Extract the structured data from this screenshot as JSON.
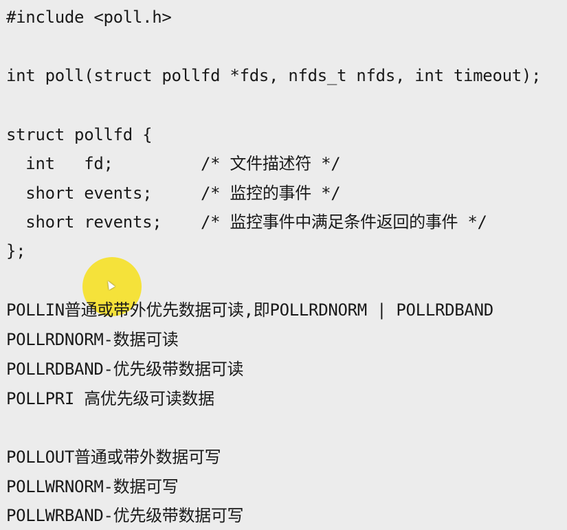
{
  "code": {
    "include_line": "#include <poll.h>",
    "poll_signature": "int poll(struct pollfd *fds, nfds_t nfds, int timeout);",
    "struct_open": "struct pollfd {",
    "field_fd": "  int   fd;         /* 文件描述符 */",
    "field_events": "  short events;     /* 监控的事件 */",
    "field_revents": "  short revents;    /* 监控事件中满足条件返回的事件 */",
    "struct_close": "};"
  },
  "flags": {
    "pollin": "POLLIN普通或带外优先数据可读,即POLLRDNORM | POLLRDBAND",
    "pollrdnorm": "POLLRDNORM-数据可读",
    "pollrdband": "POLLRDBAND-优先级带数据可读",
    "pollpri": "POLLPRI 高优先级可读数据",
    "pollout": "POLLOUT普通或带外数据可写",
    "pollwrnorm": "POLLWRNORM-数据可写",
    "pollwrband": "POLLWRBAND-优先级带数据可写"
  },
  "colors": {
    "background": "#ececec",
    "text": "#1a1a1a",
    "cursor_highlight": "#f5e12a"
  },
  "icons": {
    "cursor": "mouse-pointer-icon"
  }
}
